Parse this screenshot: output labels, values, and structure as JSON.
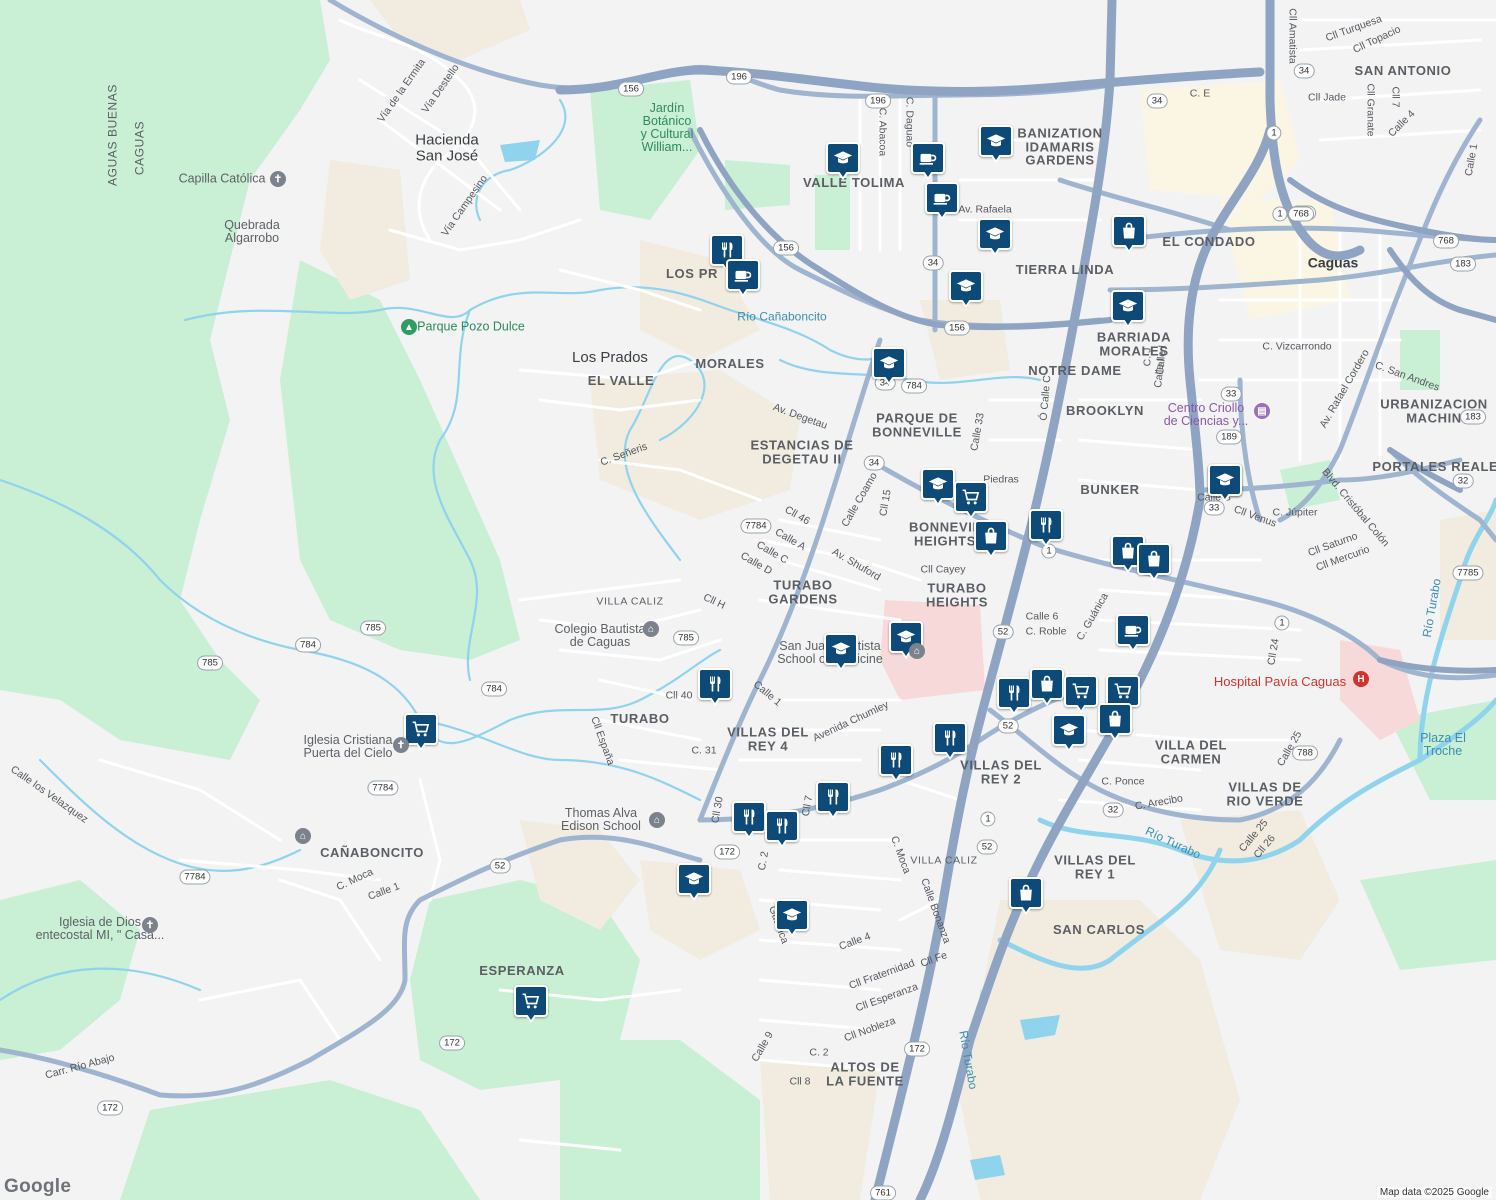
{
  "colors": {
    "background": "#f3f3f4",
    "green": "#c9efd5",
    "sand": "#f1ecdf",
    "urban": "#eef0f4",
    "water": "#8fd3ec",
    "highway": "#8ea4c2",
    "road": "#ffffff",
    "marker": "#0d4a78",
    "hospital_area": "#f8d9d9"
  },
  "areas": [
    {
      "text": "BANIZATION\nIDAMARIS\nGARDENS"
    },
    {
      "text": "VALLE TOLIMA"
    },
    {
      "text": "TIERRA LINDA"
    },
    {
      "text": "EL CONDADO"
    },
    {
      "text": "SAN ANTONIO"
    },
    {
      "text": "BARRIADA\nMORALES"
    },
    {
      "text": "NOTRE DAME"
    },
    {
      "text": "BROOKLYN"
    },
    {
      "text": "PARQUE DE\nBONNEVILLE"
    },
    {
      "text": "ESTANCIAS DE\nDEGETAU II"
    },
    {
      "text": "BUNKER"
    },
    {
      "text": "URBANIZACION\nMACHIN"
    },
    {
      "text": "PORTALES REALES"
    },
    {
      "text": "BONNEVIL\nHEIGHTS"
    },
    {
      "text": "TURABO\nGARDENS"
    },
    {
      "text": "TURABO\nHEIGHTS"
    },
    {
      "text": "MORALES"
    },
    {
      "text": "EL VALLE"
    },
    {
      "text": "LOS PR"
    },
    {
      "text": "VILLA CALIZ"
    },
    {
      "text": "TURABO"
    },
    {
      "text": "VILLAS DEL\nREY 4"
    },
    {
      "text": "VILLAS DEL\nREY 2"
    },
    {
      "text": "VILLA DEL\nCARMEN"
    },
    {
      "text": "VILLAS DE\nRIO VERDE"
    },
    {
      "text": "VILLAS DEL\nREY 1"
    },
    {
      "text": "SAN CARLOS"
    },
    {
      "text": "CAÑABONCITO"
    },
    {
      "text": "ESPERANZA"
    },
    {
      "text": "ALTOS DE\nLA FUENTE"
    },
    {
      "text": "VILLA CALIZ"
    },
    {
      "text": "AGUAS BUENAS"
    },
    {
      "text": "CAGUAS"
    }
  ],
  "towns": [
    {
      "text": "Hacienda\nSan José"
    },
    {
      "text": "Los Prados"
    },
    {
      "text": "Caguas"
    }
  ],
  "pois": [
    {
      "text": "Jardín\nBotánico\ny Cultural\nWilliam..."
    },
    {
      "text": "Capilla Católica"
    },
    {
      "text": "Quebrada\nAlgarrobo"
    },
    {
      "text": "Parque Pozo Dulce"
    },
    {
      "text": "Colegio Bautista\nde Caguas"
    },
    {
      "text": "San Juan Bautista\nSchool of Medicine"
    },
    {
      "text": "Iglesia Cristiana\nPuerta del Cielo"
    },
    {
      "text": "Thomas Alva\nEdison School"
    },
    {
      "text": "Iglesia de Dios\nentecostal MI, \" Casa..."
    },
    {
      "text": "Centro Criollo\nde Ciencias y..."
    },
    {
      "text": "Plaza El\nTroche"
    }
  ],
  "water_labels": [
    {
      "text": "Río Cañaboncito"
    },
    {
      "text": "Río Turabo"
    },
    {
      "text": "Río Turabo"
    },
    {
      "text": "Río Turabo"
    }
  ],
  "hospital": {
    "text": "Hospital Pavía Caguas"
  },
  "streets": [
    {
      "text": "Vía de la Ermita"
    },
    {
      "text": "Vía Destello"
    },
    {
      "text": "Vía Campesino"
    },
    {
      "text": "C. Señeris"
    },
    {
      "text": "Av. Degetau"
    },
    {
      "text": "C. Abacoa"
    },
    {
      "text": "C. Daguao"
    },
    {
      "text": "Av. Rafaela"
    },
    {
      "text": "C. E"
    },
    {
      "text": "Cll Amatista"
    },
    {
      "text": "Cll Turquesa"
    },
    {
      "text": "Cll Topacio"
    },
    {
      "text": "Cll Jade"
    },
    {
      "text": "Cll Granate"
    },
    {
      "text": "Cll 7"
    },
    {
      "text": "Calle 4"
    },
    {
      "text": "Calle 1"
    },
    {
      "text": "C. Vizcarrondo"
    },
    {
      "text": "C. San Andres"
    },
    {
      "text": "Av. Rafael Cordero"
    },
    {
      "text": "Blvd. Cristóbal Colón"
    },
    {
      "text": "C. Júpiter"
    },
    {
      "text": "Cll Venus"
    },
    {
      "text": "Cll Saturno"
    },
    {
      "text": "Cll Mercurio"
    },
    {
      "text": "Calle B"
    },
    {
      "text": "Calle 33"
    },
    {
      "text": "Ó Calle C"
    },
    {
      "text": "Calle I"
    },
    {
      "text": "C. J"
    },
    {
      "text": "Calle Coamo"
    },
    {
      "text": "Cll 15"
    },
    {
      "text": "Cll 46"
    },
    {
      "text": "Calle A"
    },
    {
      "text": "Calle C"
    },
    {
      "text": "Calle D"
    },
    {
      "text": "Av. Shuford"
    },
    {
      "text": "Cll Cayey"
    },
    {
      "text": "Cll H"
    },
    {
      "text": "Calle 6"
    },
    {
      "text": "C. Roble"
    },
    {
      "text": "C. Guánica"
    },
    {
      "text": "Piedras"
    },
    {
      "text": "Cll 40"
    },
    {
      "text": "Calle 1"
    },
    {
      "text": "Avenida Chumley"
    },
    {
      "text": "Cll España"
    },
    {
      "text": "C. 31"
    },
    {
      "text": "Cll 30"
    },
    {
      "text": "Cll 7"
    },
    {
      "text": "C. 2"
    },
    {
      "text": "C. Moca"
    },
    {
      "text": "C. Ponce"
    },
    {
      "text": "C. Arecibo"
    },
    {
      "text": "Calle 25"
    },
    {
      "text": "Calle 25"
    },
    {
      "text": "Cll 26"
    },
    {
      "text": "Cll 24"
    },
    {
      "text": "Calle Bonanza"
    },
    {
      "text": "Calle 4"
    },
    {
      "text": "Cll Fe"
    },
    {
      "text": "Cll Fraternidad"
    },
    {
      "text": "Cll Esperanza"
    },
    {
      "text": "Cll Nobleza"
    },
    {
      "text": "Calle 9"
    },
    {
      "text": "C. 2"
    },
    {
      "text": "Cll 8"
    },
    {
      "text": "Calle los Velazquez"
    },
    {
      "text": "C. Moca"
    },
    {
      "text": "Calle 1"
    },
    {
      "text": "Carr. Río Abajo"
    },
    {
      "text": "Guánica"
    },
    {
      "text": "Calle I"
    }
  ],
  "route_shields": [
    "196",
    "196",
    "156",
    "156",
    "156",
    "34",
    "34",
    "34",
    "34",
    "34",
    "1",
    "1",
    "1",
    "1",
    "33",
    "33",
    "189",
    "189",
    "768",
    "768",
    "183",
    "183",
    "32",
    "32",
    "788",
    "7785",
    "784",
    "7784",
    "785",
    "785",
    "785",
    "784",
    "784",
    "7784",
    "7784",
    "172",
    "172",
    "172",
    "52",
    "52",
    "52",
    "52",
    "1",
    "761",
    "172"
  ],
  "markers": [
    {
      "icon": "school-icon"
    },
    {
      "icon": "coffee-icon"
    },
    {
      "icon": "school-icon"
    },
    {
      "icon": "coffee-icon"
    },
    {
      "icon": "school-icon"
    },
    {
      "icon": "school-icon"
    },
    {
      "icon": "shopping-bag-icon"
    },
    {
      "icon": "school-icon"
    },
    {
      "icon": "restaurant-icon"
    },
    {
      "icon": "coffee-icon"
    },
    {
      "icon": "school-icon"
    },
    {
      "icon": "school-icon"
    },
    {
      "icon": "cart-icon"
    },
    {
      "icon": "shopping-bag-icon"
    },
    {
      "icon": "restaurant-icon"
    },
    {
      "icon": "shopping-bag-icon"
    },
    {
      "icon": "shopping-bag-icon"
    },
    {
      "icon": "school-icon"
    },
    {
      "icon": "coffee-icon"
    },
    {
      "icon": "school-icon"
    },
    {
      "icon": "school-icon"
    },
    {
      "icon": "restaurant-icon"
    },
    {
      "icon": "restaurant-icon"
    },
    {
      "icon": "shopping-bag-icon"
    },
    {
      "icon": "cart-icon"
    },
    {
      "icon": "cart-icon"
    },
    {
      "icon": "school-icon"
    },
    {
      "icon": "shopping-bag-icon"
    },
    {
      "icon": "restaurant-icon"
    },
    {
      "icon": "restaurant-icon"
    },
    {
      "icon": "restaurant-icon"
    },
    {
      "icon": "restaurant-icon"
    },
    {
      "icon": "restaurant-icon"
    },
    {
      "icon": "school-icon"
    },
    {
      "icon": "school-icon"
    },
    {
      "icon": "cart-icon"
    },
    {
      "icon": "cart-icon"
    },
    {
      "icon": "shopping-bag-icon"
    },
    {
      "icon": "school-icon"
    }
  ],
  "attribution": "Map data ©2025 Google",
  "logo": "Google"
}
